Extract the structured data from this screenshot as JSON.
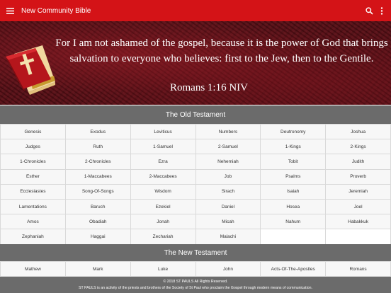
{
  "app": {
    "title": "New Community Bible",
    "accent_color": "#d41317",
    "menu_icon": "hamburger-menu-icon",
    "search_icon": "search-icon",
    "more_icon": "more-vertical-icon"
  },
  "banner": {
    "verse_line1": "For I am not ashamed of the gospel, because it is the power of God that brings",
    "verse_line2": "salvation to everyone who believes: first to the Jew, then to the Gentile.",
    "reference": "Romans 1:16 NIV",
    "icon": "bible-book-icon"
  },
  "old_testament": {
    "header": "The Old Testament",
    "books": [
      "Genesis",
      "Exodus",
      "Leviticus",
      "Numbers",
      "Deutronomy",
      "Joshua",
      "Judges",
      "Ruth",
      "1-Samuel",
      "2-Samuel",
      "1-Kings",
      "2-Kings",
      "1-Chronicles",
      "2-Chronicles",
      "Ezra",
      "Nehemiah",
      "Tobit",
      "Judith",
      "Esther",
      "1-Maccabees",
      "2-Maccabees",
      "Job",
      "Psalms",
      "Proverb",
      "Ecclesiastes",
      "Song-Of-Songs",
      "Wisdom",
      "Sirach",
      "Isaiah",
      "Jeremiah",
      "Lamentations",
      "Baruch",
      "Ezekiel",
      "Daniel",
      "Hosea",
      "Joel",
      "Amos",
      "Obadiah",
      "Jonah",
      "Micah",
      "Nahum",
      "Habakkuk",
      "Zephaniah",
      "Haggai",
      "Zechariah",
      "Malachi"
    ]
  },
  "new_testament": {
    "header": "The New Testament",
    "books": [
      "Mathew",
      "Mark",
      "Luke",
      "John",
      "Acts-Of-The-Apostles",
      "Romans"
    ]
  },
  "footer": {
    "copyright": "© 2018 ST PAULS All Rights Reserved.",
    "about": "ST PAULS is an activity of the priests and brothers of the Society of St Paul who proclaim the Gospel through modern means of communication."
  }
}
